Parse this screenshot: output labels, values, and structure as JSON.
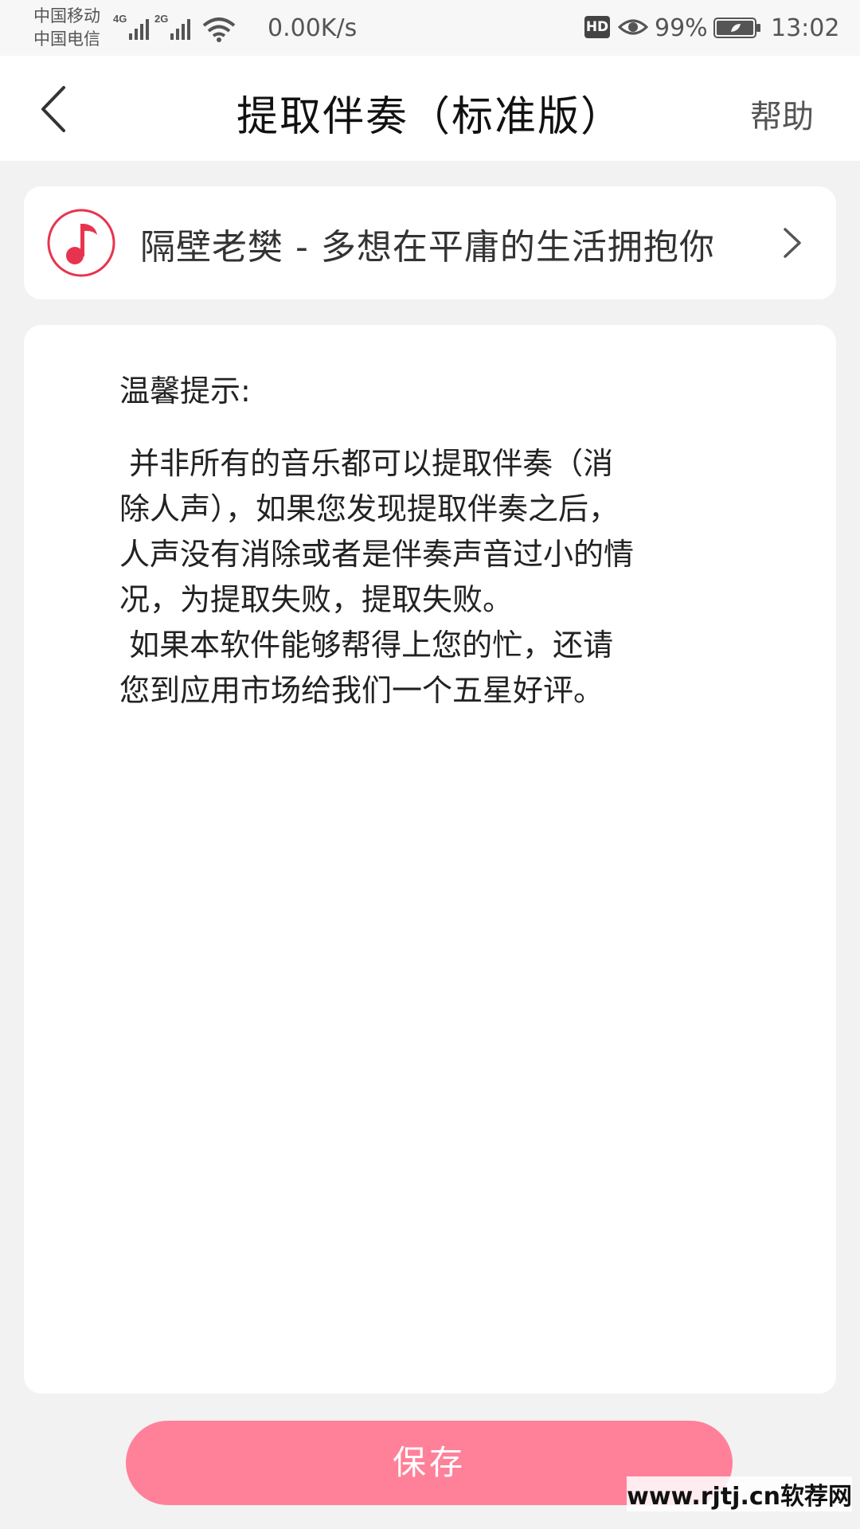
{
  "status_bar": {
    "carrier_1": "中国移动",
    "carrier_2": "中国电信",
    "signal_1_label": "4G",
    "signal_2_label": "2G",
    "net_speed": "0.00K/s",
    "hd_label": "HD",
    "battery_percent": "99%",
    "time": "13:02"
  },
  "header": {
    "title": "提取伴奏（标准版）",
    "help_label": "帮助"
  },
  "song": {
    "title": "隔壁老樊 - 多想在平庸的生活拥抱你",
    "icon": "music-note-icon"
  },
  "tips": {
    "heading": "温馨提示:",
    "body": " 并非所有的音乐都可以提取伴奏（消\n除人声），如果您发现提取伴奏之后，\n人声没有消除或者是伴奏声音过小的情\n况，为提取失败，提取失败。\n 如果本软件能够帮得上您的忙，还请\n您到应用市场给我们一个五星好评。"
  },
  "actions": {
    "save_label": "保存"
  },
  "watermark": "www.rjtj.cn软荐网",
  "colors": {
    "accent": "#ff8199",
    "icon_red": "#e8334f",
    "background": "#f2f2f2"
  }
}
